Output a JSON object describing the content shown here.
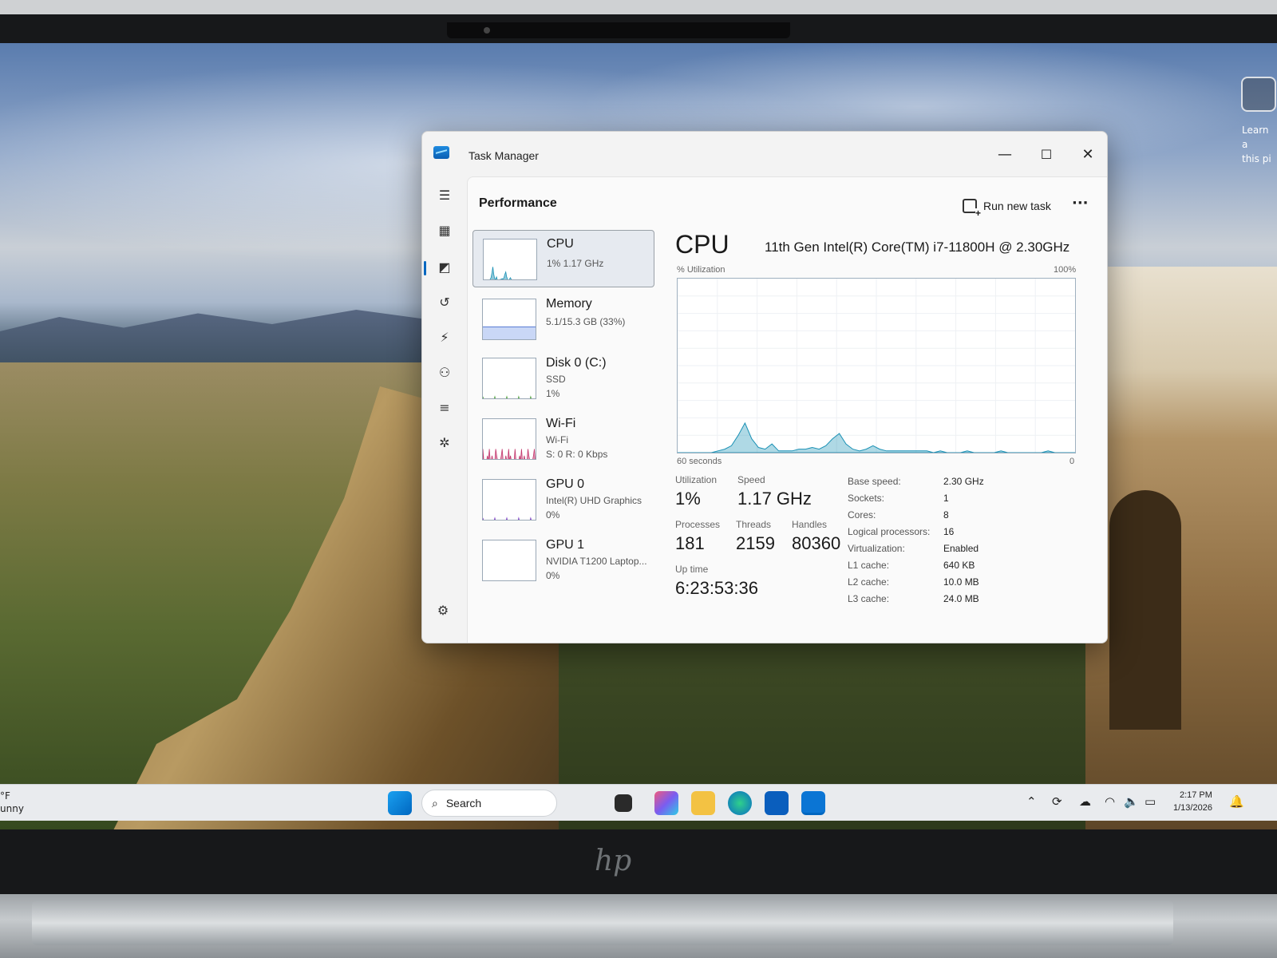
{
  "desktop": {
    "learn_text_1": "Learn a",
    "learn_text_2": "this pi"
  },
  "window": {
    "title": "Task Manager",
    "controls": {
      "minimize": "—",
      "maximize": "☐",
      "close": "✕"
    }
  },
  "nav": {
    "items": [
      "menu-icon",
      "processes-icon",
      "performance-icon",
      "app-history-icon",
      "startup-apps-icon",
      "users-icon",
      "details-icon",
      "services-icon"
    ],
    "active_index": 2,
    "settings": "settings-icon"
  },
  "page": {
    "title": "Performance",
    "run_new_task": "Run new task",
    "more": "···"
  },
  "devices": [
    {
      "name": "CPU",
      "line1": "1% 1.17 GHz",
      "line2": "",
      "color": "#1b91b5"
    },
    {
      "name": "Memory",
      "line1": "5.1/15.3 GB (33%)",
      "line2": "",
      "color": "#8a2be2"
    },
    {
      "name": "Disk 0 (C:)",
      "line1": "SSD",
      "line2": "1%",
      "color": "#4c9f38"
    },
    {
      "name": "Wi-Fi",
      "line1": "Wi-Fi",
      "line2": "S: 0 R: 0 Kbps",
      "color": "#c3366c"
    },
    {
      "name": "GPU 0",
      "line1": "Intel(R) UHD Graphics",
      "line2": "0%",
      "color": "#7d3fc6"
    },
    {
      "name": "GPU 1",
      "line1": "NVIDIA T1200 Laptop...",
      "line2": "0%",
      "color": "#7d3fc6"
    }
  ],
  "cpu_detail": {
    "title": "CPU",
    "model": "11th Gen Intel(R) Core(TM) i7-11800H @ 2.30GHz",
    "graph_label": "% Utilization",
    "graph_max": "100%",
    "graph_time": "60 seconds",
    "graph_min": "0",
    "utilization_label": "Utilization",
    "utilization": "1%",
    "speed_label": "Speed",
    "speed": "1.17 GHz",
    "processes_label": "Processes",
    "processes": "181",
    "threads_label": "Threads",
    "threads": "2159",
    "handles_label": "Handles",
    "handles": "80360",
    "uptime_label": "Up time",
    "uptime": "6:23:53:36",
    "specs": [
      {
        "label": "Base speed:",
        "value": "2.30 GHz"
      },
      {
        "label": "Sockets:",
        "value": "1"
      },
      {
        "label": "Cores:",
        "value": "8"
      },
      {
        "label": "Logical processors:",
        "value": "16"
      },
      {
        "label": "Virtualization:",
        "value": "Enabled"
      },
      {
        "label": "L1 cache:",
        "value": "640 KB"
      },
      {
        "label": "L2 cache:",
        "value": "10.0 MB"
      },
      {
        "label": "L3 cache:",
        "value": "24.0 MB"
      }
    ],
    "utilization_history": [
      0,
      0,
      0,
      0,
      0,
      0,
      1,
      2,
      4,
      10,
      17,
      8,
      3,
      2,
      5,
      1,
      1,
      1,
      2,
      2,
      3,
      2,
      4,
      8,
      11,
      5,
      2,
      1,
      2,
      4,
      2,
      1,
      1,
      1,
      1,
      1,
      1,
      1,
      0,
      1,
      0,
      0,
      0,
      1,
      0,
      0,
      0,
      0,
      1,
      0,
      0,
      0,
      0,
      0,
      0,
      1,
      0,
      0,
      0,
      0
    ]
  },
  "taskbar": {
    "weather_temp": "°F",
    "weather_desc": "unny",
    "search_placeholder": "Search",
    "time": "2:17 PM",
    "date": "1/13/2026"
  },
  "brand": "hp"
}
